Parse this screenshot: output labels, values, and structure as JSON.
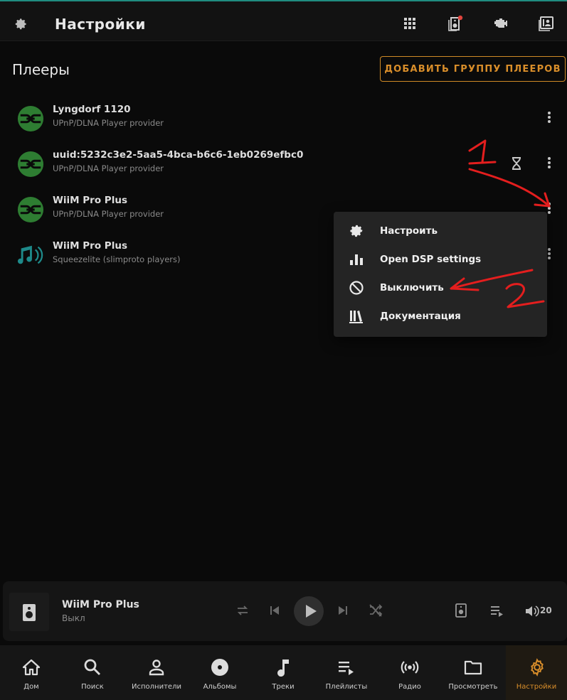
{
  "appbar": {
    "title": "Настройки",
    "icons": [
      "settings-gear-icon",
      "grid-icon",
      "speaker-badge-icon",
      "plugin-icon",
      "account-box-icon"
    ]
  },
  "section": {
    "title": "Плееры",
    "add_button": "ДОБАВИТЬ ГРУППУ ПЛЕЕРОВ"
  },
  "players": [
    {
      "name": "Lyngdorf 1120",
      "provider": "UPnP/DLNA Player provider",
      "icon": "dlna-icon"
    },
    {
      "name": "uuid:5232c3e2-5aa5-4bca-b6c6-1eb0269efbc0",
      "provider": "UPnP/DLNA Player provider",
      "icon": "dlna-icon",
      "status_icon": "hourglass-icon"
    },
    {
      "name": "WiiM Pro Plus",
      "provider": "UPnP/DLNA Player provider",
      "icon": "dlna-icon"
    },
    {
      "name": "WiiM Pro Plus",
      "provider": "Squeezelite (slimproto players)",
      "icon": "music-notes-icon"
    }
  ],
  "context_menu": {
    "items": [
      {
        "label": "Настроить",
        "icon": "cog-icon"
      },
      {
        "label": "Open DSP settings",
        "icon": "equalizer-bars-icon"
      },
      {
        "label": "Выключить",
        "icon": "block-icon"
      },
      {
        "label": "Документация",
        "icon": "library-icon"
      }
    ]
  },
  "annotations": {
    "mark_1": "1",
    "mark_2": "2",
    "color": "#e41e1e"
  },
  "now_playing": {
    "title": "WiiM Pro Plus",
    "status": "Выкл",
    "volume": "20"
  },
  "nav": {
    "items": [
      {
        "label": "Дом",
        "icon": "home-icon"
      },
      {
        "label": "Поиск",
        "icon": "search-icon"
      },
      {
        "label": "Исполнители",
        "icon": "artist-icon"
      },
      {
        "label": "Альбомы",
        "icon": "album-icon"
      },
      {
        "label": "Треки",
        "icon": "music-note-icon"
      },
      {
        "label": "Плейлисты",
        "icon": "playlist-icon"
      },
      {
        "label": "Радио",
        "icon": "radio-icon"
      },
      {
        "label": "Просмотреть",
        "icon": "folder-icon"
      },
      {
        "label": "Настройки",
        "icon": "settings-icon",
        "active": true
      }
    ]
  },
  "colors": {
    "accent": "#d98e2a",
    "dlna_green": "#2e7d32",
    "squeeze_teal": "#1e8a8a",
    "top_line": "#1f8c80"
  }
}
